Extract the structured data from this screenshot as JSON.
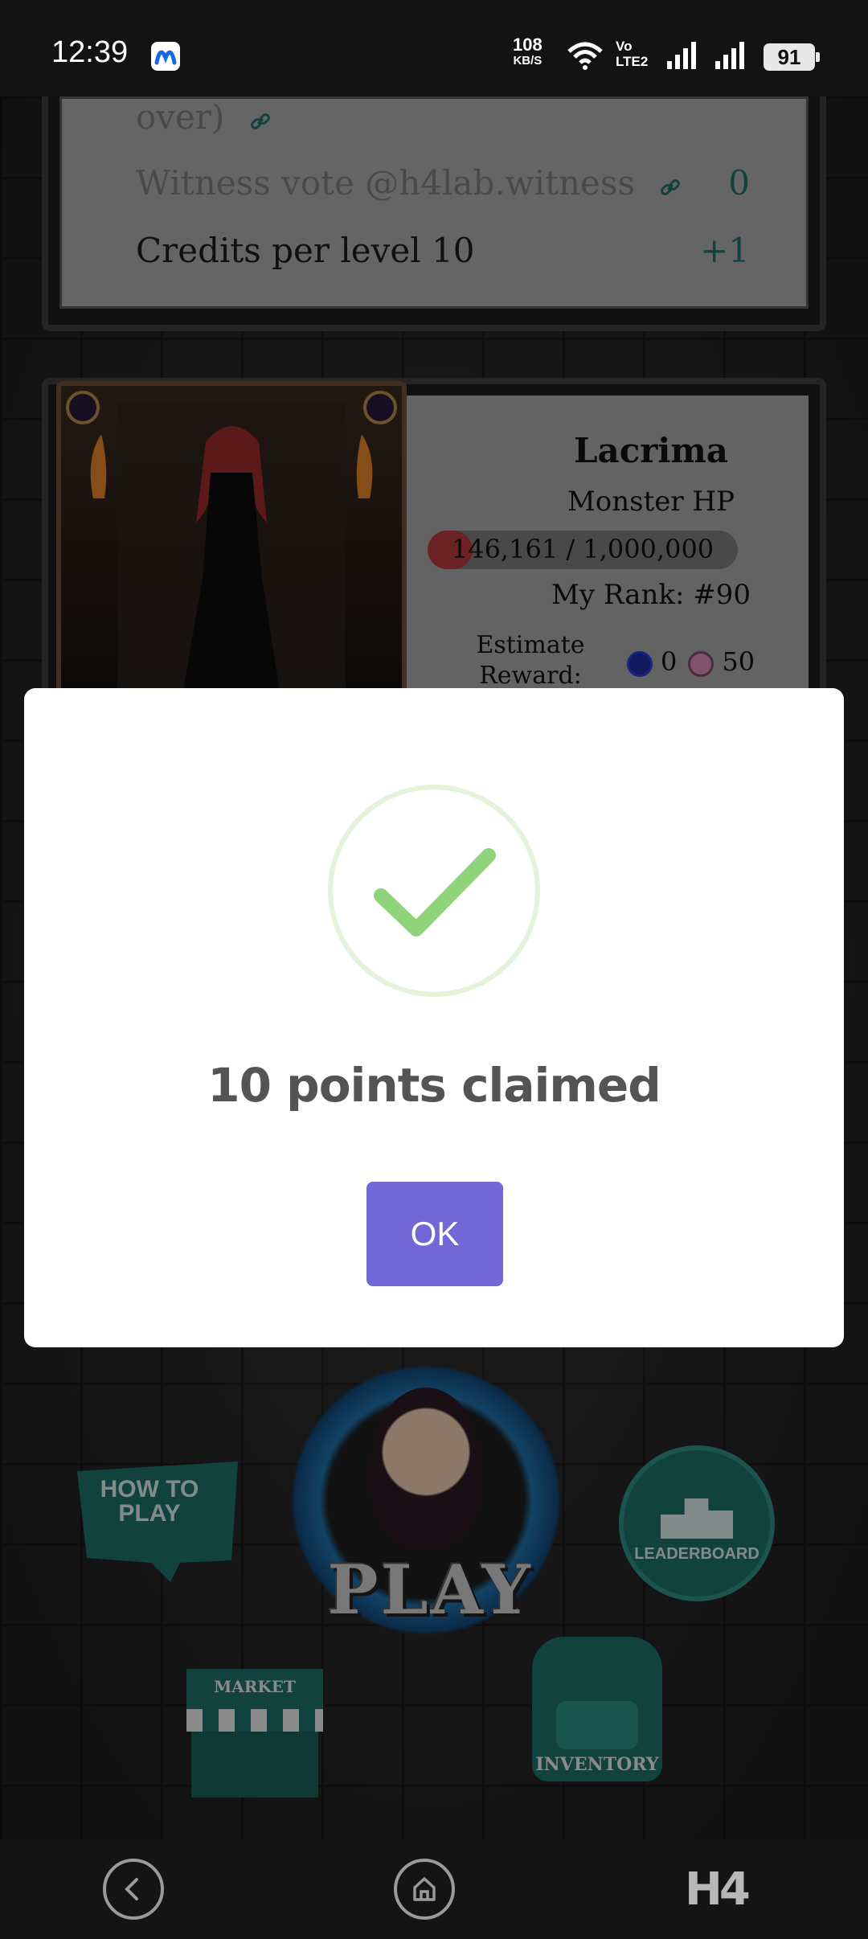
{
  "status_bar": {
    "time": "12:39",
    "net_speed_value": "108",
    "net_speed_unit": "KB/S",
    "volte_top": "Vo",
    "volte_bottom": "LTE2",
    "battery": "91"
  },
  "credits_panel": {
    "row_partial": "over)",
    "row_witness_label": "Witness vote @h4lab.witness",
    "row_witness_value": "0",
    "row_credits_label": "Credits per level 10",
    "row_credits_value": "+1"
  },
  "boss": {
    "name": "Lacrima",
    "hp_label": "Monster HP",
    "hp_text": "146,161 / 1,000,000",
    "hp_fraction": 0.146,
    "rank_text": "My Rank: #90",
    "reward_label": "Estimate Reward:",
    "reward_steem": "0",
    "reward_token": "50"
  },
  "modal": {
    "title": "10 points claimed",
    "ok_label": "OK"
  },
  "menu": {
    "play_label": "PLAY",
    "howto_label": "HOW TO PLAY",
    "leaderboard_label": "LEADERBOARD",
    "market_label": "MARKET",
    "inventory_label": "INVENTORY"
  },
  "nav": {
    "logo": "H4"
  },
  "colors": {
    "accent": "#7367d8",
    "success": "#8fd47a",
    "teal": "#1f6e68",
    "hp_fill": "#b23a3a"
  }
}
